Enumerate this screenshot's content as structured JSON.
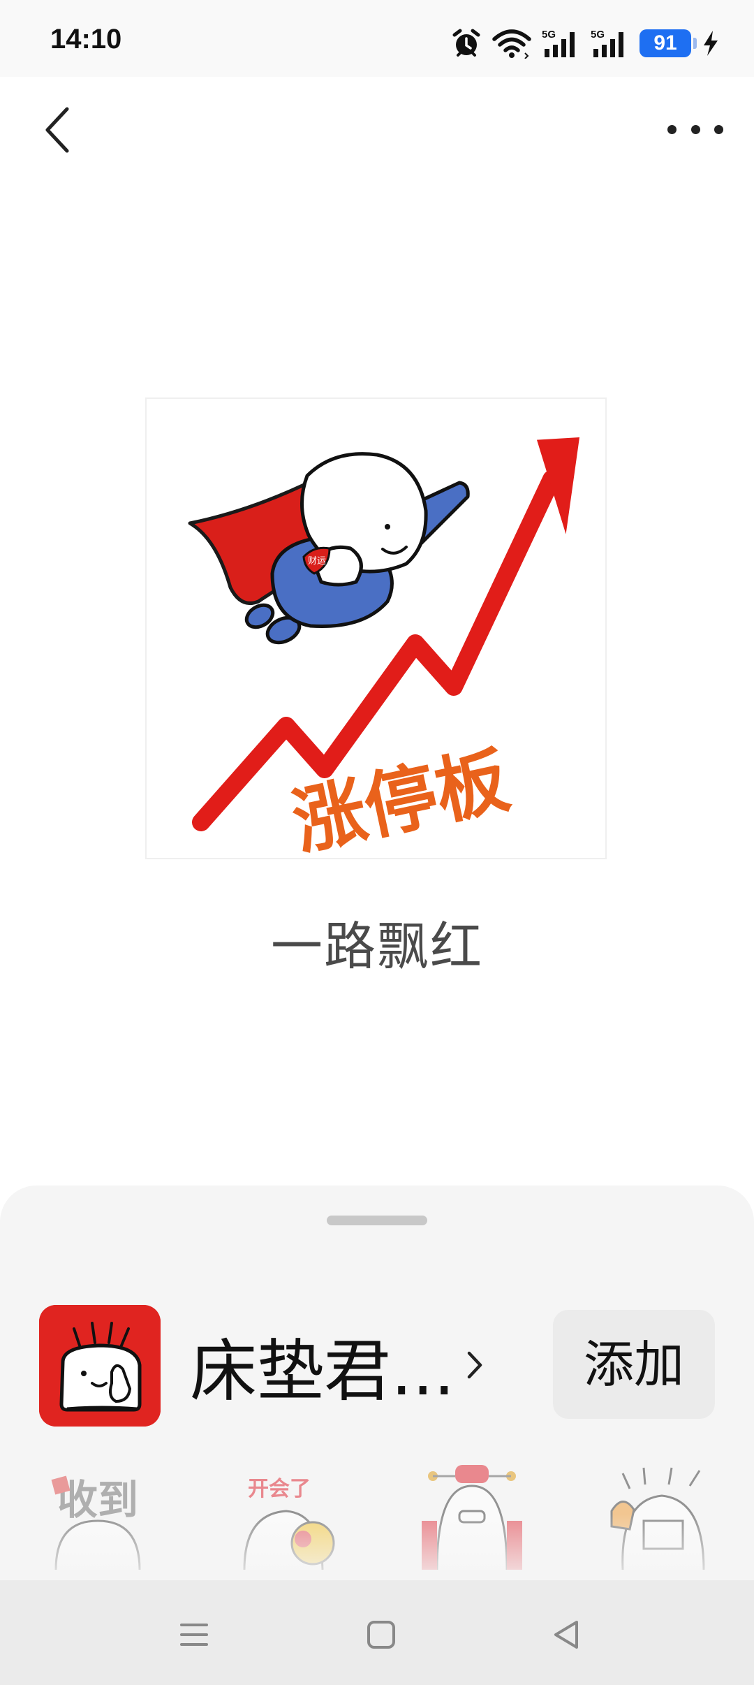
{
  "status_bar": {
    "time": "14:10",
    "battery_level": "91",
    "signal_1_label": "5G",
    "signal_2_label": "5G",
    "icons": [
      "alarm-icon",
      "wifi-icon",
      "signal-icon",
      "signal-icon",
      "battery-icon",
      "charging-icon"
    ]
  },
  "nav": {
    "back_icon": "chevron-left-icon",
    "more_icon": "more-horizontal-icon"
  },
  "sticker": {
    "caption": "一路飘红",
    "image_text": "涨停板",
    "badge_text": "财运"
  },
  "pack": {
    "name": "床垫君...",
    "add_label": "添加",
    "thumbnails": [
      {
        "text": "收到"
      },
      {
        "text": "开会了"
      },
      {
        "text": ""
      },
      {
        "text": ""
      }
    ]
  },
  "system_nav": {
    "icons": [
      "menu-icon",
      "home-icon",
      "back-triangle-icon"
    ]
  },
  "colors": {
    "accent_red": "#e02420",
    "battery_blue": "#1e6ff2",
    "sticker_orange": "#e9621b",
    "character_blue": "#4a6fc4"
  }
}
